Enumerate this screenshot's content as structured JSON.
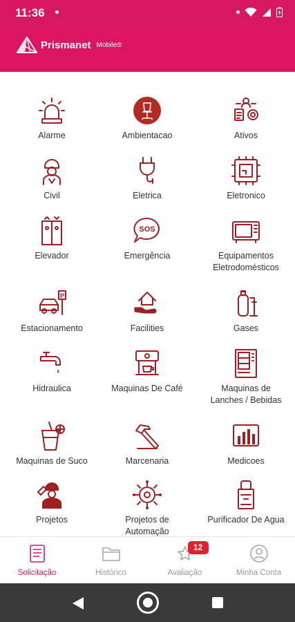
{
  "status": {
    "time": "11:36"
  },
  "header": {
    "brand": "Prismanet",
    "brand_sub": "Mobile®"
  },
  "colors": {
    "brand": "#d8185e",
    "icon": "#a01f22",
    "text": "#333333"
  },
  "services": [
    {
      "label": "Alarme",
      "icon": "alarm-siren-icon"
    },
    {
      "label": "Ambientacao",
      "icon": "office-chair-icon"
    },
    {
      "label": "Ativos",
      "icon": "assets-icon"
    },
    {
      "label": "Civil",
      "icon": "construction-worker-icon"
    },
    {
      "label": "Eletrica",
      "icon": "power-plug-icon"
    },
    {
      "label": "Eletronico",
      "icon": "circuit-chip-icon"
    },
    {
      "label": "Elevador",
      "icon": "elevator-icon"
    },
    {
      "label": "Emergência",
      "icon": "sos-bubble-icon"
    },
    {
      "label": "Equipamentos\nEletrodomésticos",
      "icon": "microwave-icon"
    },
    {
      "label": "Estacionamento",
      "icon": "parking-car-icon"
    },
    {
      "label": "Facilities",
      "icon": "hand-house-icon"
    },
    {
      "label": "Gases",
      "icon": "gas-cylinder-icon"
    },
    {
      "label": "Hidraulica",
      "icon": "faucet-icon"
    },
    {
      "label": "Maquinas De Café",
      "icon": "coffee-machine-icon"
    },
    {
      "label": "Maquinas de\nLanches / Bebidas",
      "icon": "vending-machine-icon"
    },
    {
      "label": "Maquinas de Suco",
      "icon": "juice-glass-icon"
    },
    {
      "label": "Marcenaria",
      "icon": "hammer-icon"
    },
    {
      "label": "Medicoes",
      "icon": "bar-chart-icon"
    },
    {
      "label": "Projetos",
      "icon": "engineer-blueprint-icon"
    },
    {
      "label": "Projetos de\nAutomação",
      "icon": "automation-gear-icon"
    },
    {
      "label": "Purificador De Agua",
      "icon": "water-dispenser-icon"
    }
  ],
  "nav": [
    {
      "label": "Solicitação",
      "icon": "document-icon",
      "active": true
    },
    {
      "label": "Histórico",
      "icon": "folder-icon",
      "active": false
    },
    {
      "label": "Avaliação",
      "icon": "star-icon",
      "active": false,
      "badge": "12"
    },
    {
      "label": "Minha Conta",
      "icon": "user-account-icon",
      "active": false
    }
  ]
}
